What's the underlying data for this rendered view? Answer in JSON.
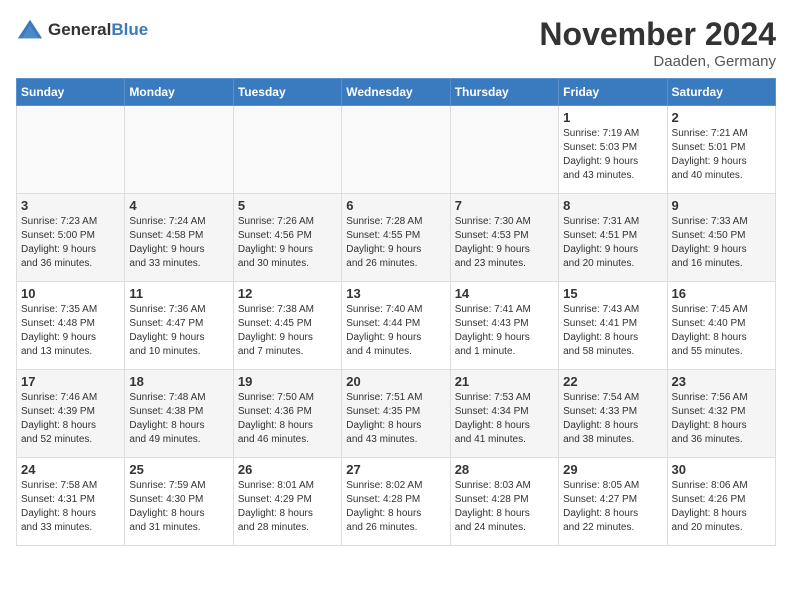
{
  "logo": {
    "text_general": "General",
    "text_blue": "Blue"
  },
  "header": {
    "month": "November 2024",
    "location": "Daaden, Germany"
  },
  "weekdays": [
    "Sunday",
    "Monday",
    "Tuesday",
    "Wednesday",
    "Thursday",
    "Friday",
    "Saturday"
  ],
  "weeks": [
    [
      {
        "day": "",
        "info": ""
      },
      {
        "day": "",
        "info": ""
      },
      {
        "day": "",
        "info": ""
      },
      {
        "day": "",
        "info": ""
      },
      {
        "day": "",
        "info": ""
      },
      {
        "day": "1",
        "info": "Sunrise: 7:19 AM\nSunset: 5:03 PM\nDaylight: 9 hours\nand 43 minutes."
      },
      {
        "day": "2",
        "info": "Sunrise: 7:21 AM\nSunset: 5:01 PM\nDaylight: 9 hours\nand 40 minutes."
      }
    ],
    [
      {
        "day": "3",
        "info": "Sunrise: 7:23 AM\nSunset: 5:00 PM\nDaylight: 9 hours\nand 36 minutes."
      },
      {
        "day": "4",
        "info": "Sunrise: 7:24 AM\nSunset: 4:58 PM\nDaylight: 9 hours\nand 33 minutes."
      },
      {
        "day": "5",
        "info": "Sunrise: 7:26 AM\nSunset: 4:56 PM\nDaylight: 9 hours\nand 30 minutes."
      },
      {
        "day": "6",
        "info": "Sunrise: 7:28 AM\nSunset: 4:55 PM\nDaylight: 9 hours\nand 26 minutes."
      },
      {
        "day": "7",
        "info": "Sunrise: 7:30 AM\nSunset: 4:53 PM\nDaylight: 9 hours\nand 23 minutes."
      },
      {
        "day": "8",
        "info": "Sunrise: 7:31 AM\nSunset: 4:51 PM\nDaylight: 9 hours\nand 20 minutes."
      },
      {
        "day": "9",
        "info": "Sunrise: 7:33 AM\nSunset: 4:50 PM\nDaylight: 9 hours\nand 16 minutes."
      }
    ],
    [
      {
        "day": "10",
        "info": "Sunrise: 7:35 AM\nSunset: 4:48 PM\nDaylight: 9 hours\nand 13 minutes."
      },
      {
        "day": "11",
        "info": "Sunrise: 7:36 AM\nSunset: 4:47 PM\nDaylight: 9 hours\nand 10 minutes."
      },
      {
        "day": "12",
        "info": "Sunrise: 7:38 AM\nSunset: 4:45 PM\nDaylight: 9 hours\nand 7 minutes."
      },
      {
        "day": "13",
        "info": "Sunrise: 7:40 AM\nSunset: 4:44 PM\nDaylight: 9 hours\nand 4 minutes."
      },
      {
        "day": "14",
        "info": "Sunrise: 7:41 AM\nSunset: 4:43 PM\nDaylight: 9 hours\nand 1 minute."
      },
      {
        "day": "15",
        "info": "Sunrise: 7:43 AM\nSunset: 4:41 PM\nDaylight: 8 hours\nand 58 minutes."
      },
      {
        "day": "16",
        "info": "Sunrise: 7:45 AM\nSunset: 4:40 PM\nDaylight: 8 hours\nand 55 minutes."
      }
    ],
    [
      {
        "day": "17",
        "info": "Sunrise: 7:46 AM\nSunset: 4:39 PM\nDaylight: 8 hours\nand 52 minutes."
      },
      {
        "day": "18",
        "info": "Sunrise: 7:48 AM\nSunset: 4:38 PM\nDaylight: 8 hours\nand 49 minutes."
      },
      {
        "day": "19",
        "info": "Sunrise: 7:50 AM\nSunset: 4:36 PM\nDaylight: 8 hours\nand 46 minutes."
      },
      {
        "day": "20",
        "info": "Sunrise: 7:51 AM\nSunset: 4:35 PM\nDaylight: 8 hours\nand 43 minutes."
      },
      {
        "day": "21",
        "info": "Sunrise: 7:53 AM\nSunset: 4:34 PM\nDaylight: 8 hours\nand 41 minutes."
      },
      {
        "day": "22",
        "info": "Sunrise: 7:54 AM\nSunset: 4:33 PM\nDaylight: 8 hours\nand 38 minutes."
      },
      {
        "day": "23",
        "info": "Sunrise: 7:56 AM\nSunset: 4:32 PM\nDaylight: 8 hours\nand 36 minutes."
      }
    ],
    [
      {
        "day": "24",
        "info": "Sunrise: 7:58 AM\nSunset: 4:31 PM\nDaylight: 8 hours\nand 33 minutes."
      },
      {
        "day": "25",
        "info": "Sunrise: 7:59 AM\nSunset: 4:30 PM\nDaylight: 8 hours\nand 31 minutes."
      },
      {
        "day": "26",
        "info": "Sunrise: 8:01 AM\nSunset: 4:29 PM\nDaylight: 8 hours\nand 28 minutes."
      },
      {
        "day": "27",
        "info": "Sunrise: 8:02 AM\nSunset: 4:28 PM\nDaylight: 8 hours\nand 26 minutes."
      },
      {
        "day": "28",
        "info": "Sunrise: 8:03 AM\nSunset: 4:28 PM\nDaylight: 8 hours\nand 24 minutes."
      },
      {
        "day": "29",
        "info": "Sunrise: 8:05 AM\nSunset: 4:27 PM\nDaylight: 8 hours\nand 22 minutes."
      },
      {
        "day": "30",
        "info": "Sunrise: 8:06 AM\nSunset: 4:26 PM\nDaylight: 8 hours\nand 20 minutes."
      }
    ]
  ]
}
